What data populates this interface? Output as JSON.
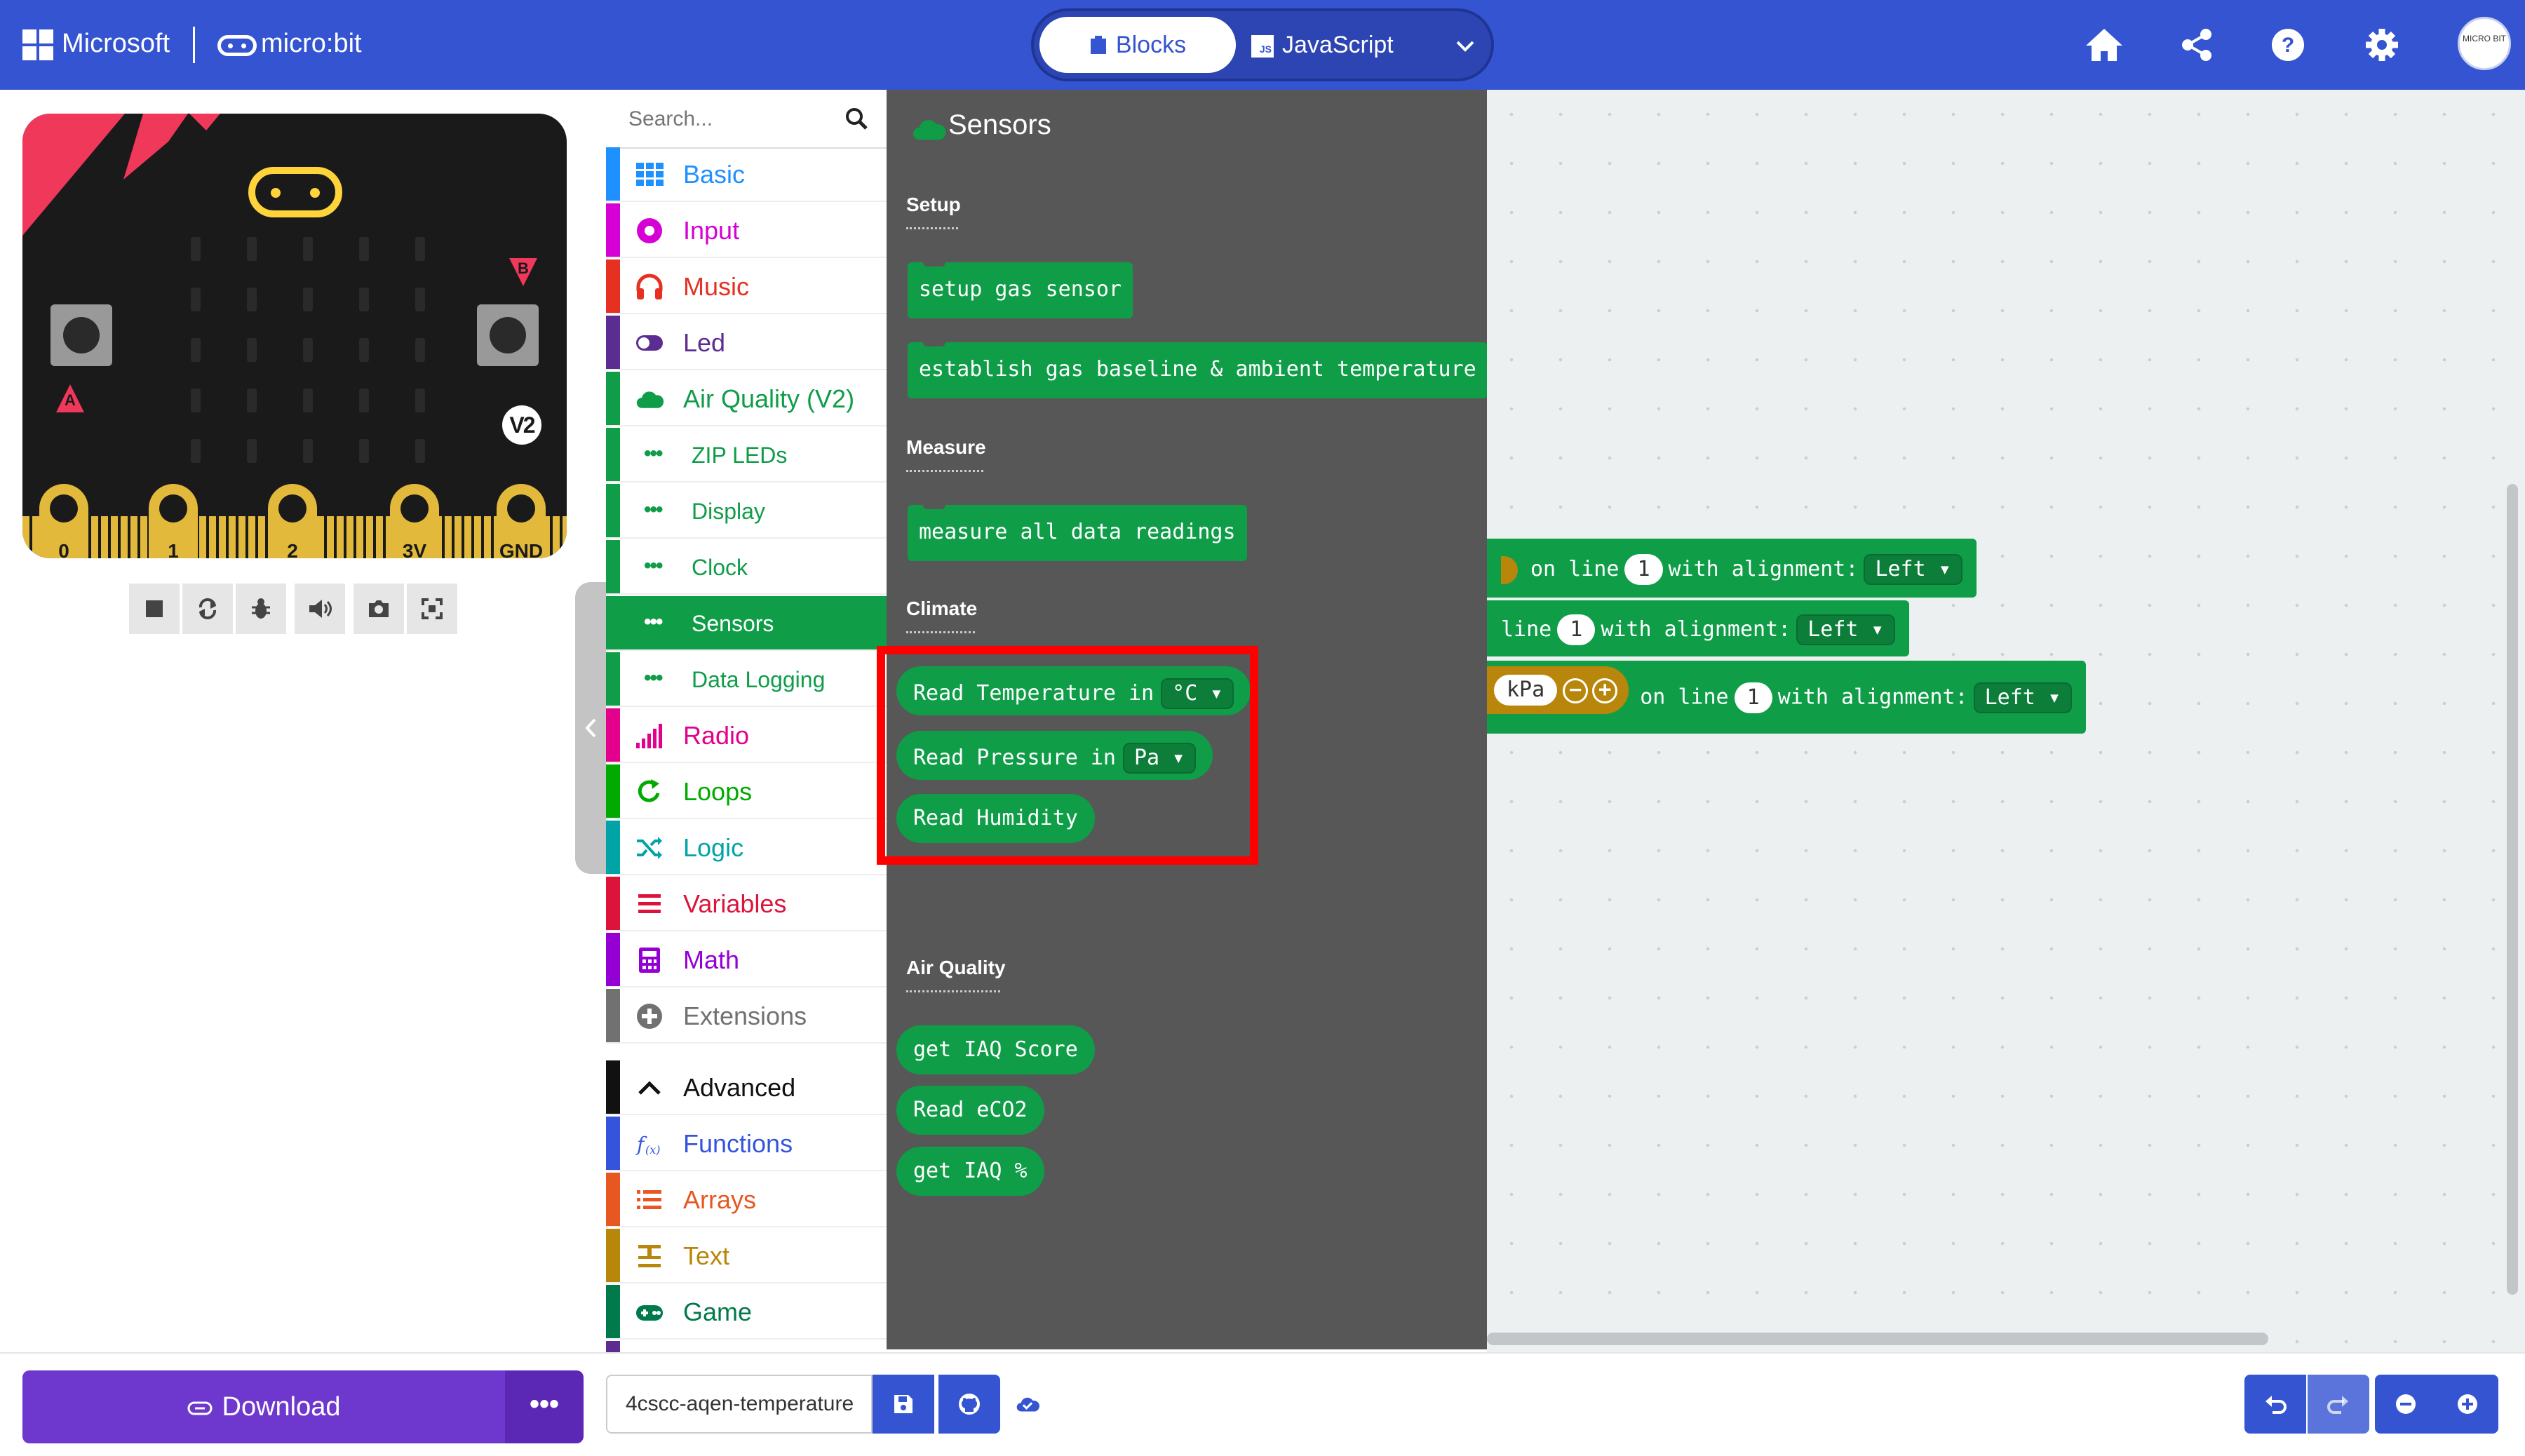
{
  "header": {
    "brand": "Microsoft",
    "product": "micro:bit",
    "tabs": {
      "blocks": "Blocks",
      "javascript": "JavaScript"
    },
    "icons": [
      "home-icon",
      "share-icon",
      "help-icon",
      "settings-icon"
    ],
    "avatar_text": "MICRO BIT"
  },
  "simulator": {
    "pins": [
      "0",
      "1",
      "2",
      "3V",
      "GND"
    ],
    "button_a": "A",
    "button_b": "B",
    "version_badge": "V2",
    "toolbar": [
      "stop-icon",
      "restart-icon",
      "debug-icon",
      "mute-icon",
      "screenshot-icon",
      "fullscreen-icon"
    ]
  },
  "toolbox": {
    "search_placeholder": "Search...",
    "categories": [
      {
        "label": "Basic",
        "color": "#1e90ff"
      },
      {
        "label": "Input",
        "color": "#d400d4"
      },
      {
        "label": "Music",
        "color": "#e63022"
      },
      {
        "label": "Led",
        "color": "#5c2d91"
      },
      {
        "label": "Air Quality (V2)",
        "color": "#0f9d48"
      },
      {
        "label": "Radio",
        "color": "#e3008c"
      },
      {
        "label": "Loops",
        "color": "#00aa00"
      },
      {
        "label": "Logic",
        "color": "#00a4a6"
      },
      {
        "label": "Variables",
        "color": "#dc143c"
      },
      {
        "label": "Math",
        "color": "#9400d3"
      },
      {
        "label": "Extensions",
        "color": "#717171"
      },
      {
        "label": "Advanced",
        "color": "#111111"
      },
      {
        "label": "Functions",
        "color": "#3455db"
      },
      {
        "label": "Arrays",
        "color": "#e65722"
      },
      {
        "label": "Text",
        "color": "#b8860b"
      },
      {
        "label": "Game",
        "color": "#007a4b"
      }
    ],
    "subcategories": [
      "ZIP LEDs",
      "Display",
      "Clock",
      "Sensors",
      "Data Logging"
    ],
    "active_subcategory": "Sensors"
  },
  "flyout": {
    "title": "Sensors",
    "sections": {
      "setup": "Setup",
      "measure": "Measure",
      "climate": "Climate",
      "air_quality": "Air Quality"
    },
    "blocks": {
      "setup_gas": "setup gas sensor",
      "baseline": "establish gas baseline & ambient temperature",
      "measure_all": "measure all data readings",
      "read_temp": "Read Temperature in",
      "temp_unit": "°C",
      "read_pressure": "Read Pressure in",
      "pressure_unit": "Pa",
      "read_humidity": "Read Humidity",
      "iaq_score": "get IAQ Score",
      "eco2": "Read eCO2",
      "iaq_percent": "get IAQ %"
    }
  },
  "workspace": {
    "row1": {
      "on_line": "on line",
      "line": "1",
      "with_alignment": "with alignment:",
      "align": "Left"
    },
    "row2": {
      "on_line": "line",
      "line": "1",
      "with_alignment": "with alignment:",
      "align": "Left"
    },
    "row3": {
      "unit": "kPa",
      "on_line": "on line",
      "line": "1",
      "with_alignment": "with alignment:",
      "align": "Left"
    }
  },
  "footer": {
    "download": "Download",
    "more": "•••",
    "project_name": "4cscc-aqen-temperature"
  }
}
